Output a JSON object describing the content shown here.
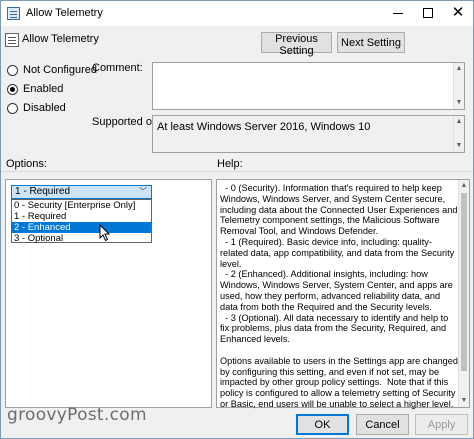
{
  "window": {
    "title": "Allow Telemetry",
    "minimize_glyph": "—",
    "maximize_glyph": "□",
    "close_glyph": "✕"
  },
  "header": {
    "title": "Allow Telemetry",
    "previous_label": "Previous Setting",
    "next_label": "Next Setting"
  },
  "state": {
    "radios": [
      {
        "label": "Not Configured",
        "checked": false
      },
      {
        "label": "Enabled",
        "checked": true
      },
      {
        "label": "Disabled",
        "checked": false
      }
    ]
  },
  "comment": {
    "label": "Comment:",
    "value": ""
  },
  "supported": {
    "label": "Supported on:",
    "value": "At least Windows Server 2016, Windows 10"
  },
  "options": {
    "label": "Options:",
    "selected": "1 - Required",
    "items": [
      {
        "label": "0 - Security [Enterprise Only]",
        "highlighted": false
      },
      {
        "label": "1 - Required",
        "highlighted": false
      },
      {
        "label": "2 - Enhanced",
        "highlighted": true
      },
      {
        "label": "3 - Optional",
        "highlighted": false
      }
    ]
  },
  "help": {
    "label": "Help:",
    "text": "  - 0 (Security). Information that's required to help keep Windows, Windows Server, and System Center secure, including data about the Connected User Experiences and Telemetry component settings, the Malicious Software Removal Tool, and Windows Defender.\n  - 1 (Required). Basic device info, including: quality-related data, app compatibility, and data from the Security level.\n  - 2 (Enhanced). Additional insights, including: how Windows, Windows Server, System Center, and apps are used, how they perform, advanced reliability data, and data from both the Required and the Security levels.\n  - 3 (Optional). All data necessary to identify and help to fix problems, plus data from the Security, Required, and Enhanced levels.\n\nOptions available to users in the Settings app are changed by configuring this setting, and even if not set, may be impacted by other group policy settings.  Note that if this policy is configured to allow a telemetry setting of Security or Basic, end users will be unable to select a higher level."
  },
  "footer": {
    "ok_label": "OK",
    "cancel_label": "Cancel",
    "apply_label": "Apply"
  },
  "watermark": "groovyPost.com"
}
